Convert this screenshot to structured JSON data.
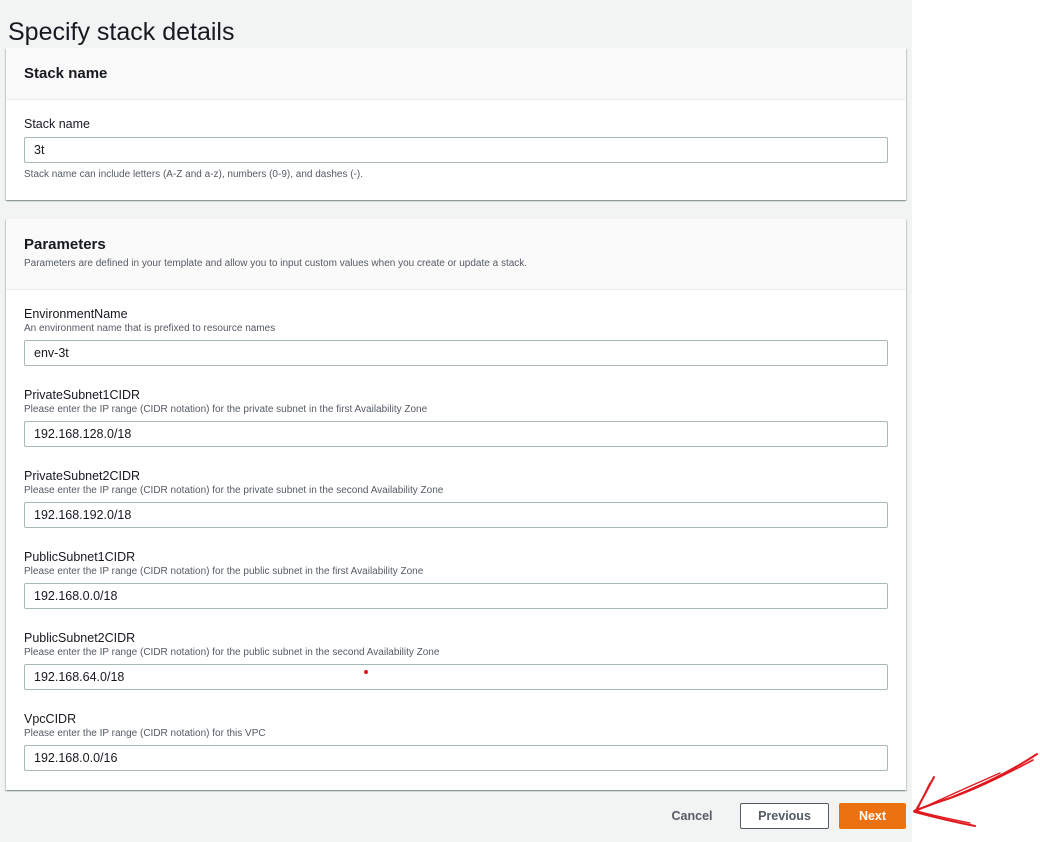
{
  "page": {
    "title": "Specify stack details"
  },
  "stack_name_section": {
    "heading": "Stack name",
    "field_label": "Stack name",
    "value": "3t",
    "hint": "Stack name can include letters (A-Z and a-z), numbers (0-9), and dashes (-)."
  },
  "parameters_section": {
    "heading": "Parameters",
    "description": "Parameters are defined in your template and allow you to input custom values when you create or update a stack.",
    "fields": [
      {
        "label": "EnvironmentName",
        "description": "An environment name that is prefixed to resource names",
        "value": "env-3t"
      },
      {
        "label": "PrivateSubnet1CIDR",
        "description": "Please enter the IP range (CIDR notation) for the private subnet in the first Availability Zone",
        "value": "192.168.128.0/18"
      },
      {
        "label": "PrivateSubnet2CIDR",
        "description": "Please enter the IP range (CIDR notation) for the private subnet in the second Availability Zone",
        "value": "192.168.192.0/18"
      },
      {
        "label": "PublicSubnet1CIDR",
        "description": "Please enter the IP range (CIDR notation) for the public subnet in the first Availability Zone",
        "value": "192.168.0.0/18"
      },
      {
        "label": "PublicSubnet2CIDR",
        "description": "Please enter the IP range (CIDR notation) for the public subnet in the second Availability Zone",
        "value": "192.168.64.0/18"
      },
      {
        "label": "VpcCIDR",
        "description": "Please enter the IP range (CIDR notation) for this VPC",
        "value": "192.168.0.0/16"
      }
    ]
  },
  "footer": {
    "cancel_label": "Cancel",
    "previous_label": "Previous",
    "next_label": "Next"
  },
  "colors": {
    "primary_button": "#ec7211",
    "annotation_ink": "#e0191f"
  }
}
